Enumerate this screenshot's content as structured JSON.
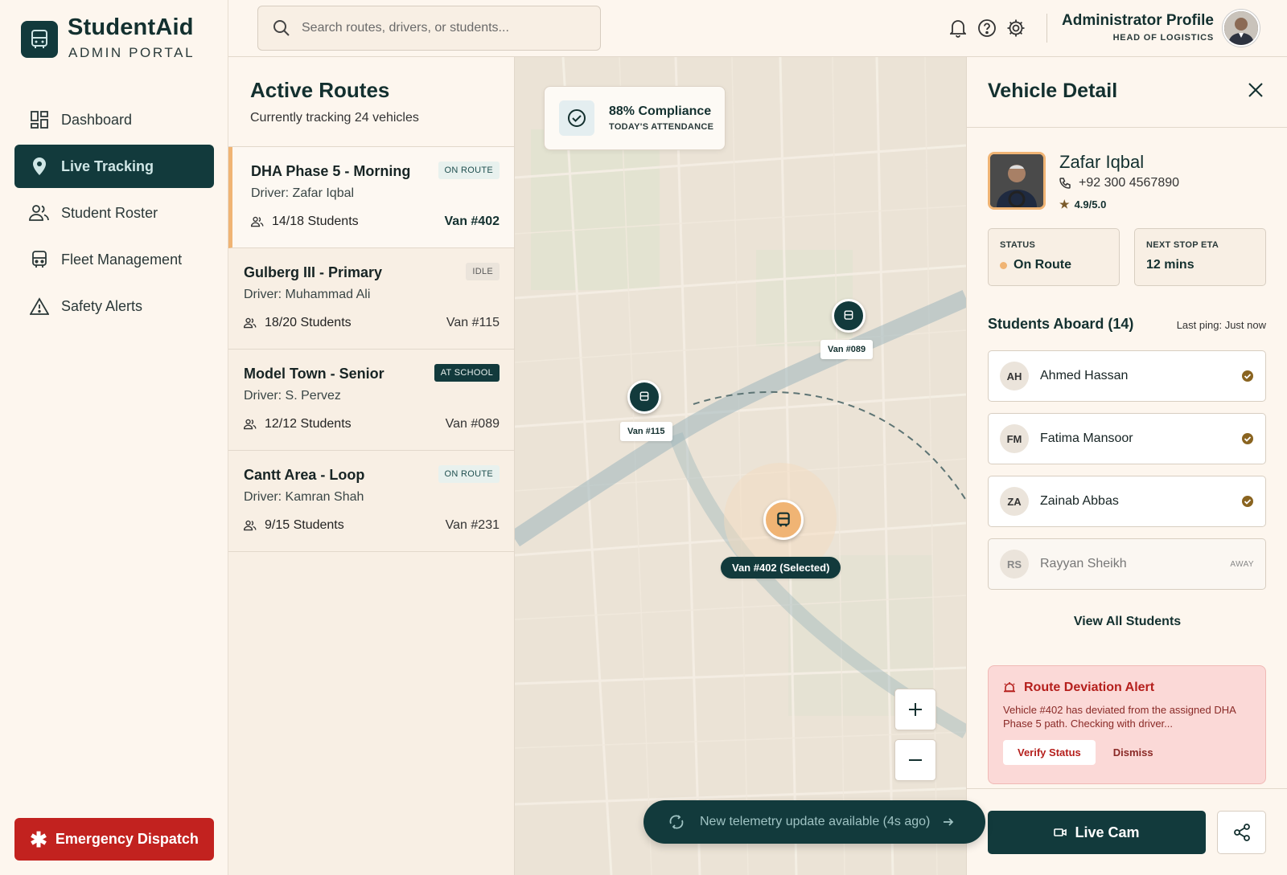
{
  "app": {
    "name": "StudentAid",
    "subtitle": "ADMIN PORTAL"
  },
  "sidebar": {
    "items": [
      {
        "label": "Dashboard",
        "icon": "dashboard-icon"
      },
      {
        "label": "Live Tracking",
        "icon": "location-pin-icon",
        "active": true
      },
      {
        "label": "Student Roster",
        "icon": "people-icon"
      },
      {
        "label": "Fleet Management",
        "icon": "bus-icon"
      },
      {
        "label": "Safety Alerts",
        "icon": "warning-icon"
      }
    ],
    "emergency_label": "Emergency Dispatch"
  },
  "search": {
    "placeholder": "Search routes, drivers, or students..."
  },
  "header": {
    "profile_name": "Administrator Profile",
    "profile_role": "HEAD OF LOGISTICS"
  },
  "routes": {
    "title": "Active Routes",
    "subtitle": "Currently tracking 24 vehicles",
    "items": [
      {
        "name": "DHA Phase 5 - Morning",
        "driver": "Driver: Zafar Iqbal",
        "status": "ON ROUTE",
        "students": "14/18 Students",
        "van": "Van #402"
      },
      {
        "name": "Gulberg III - Primary",
        "driver": "Driver: Muhammad Ali",
        "status": "IDLE",
        "students": "18/20 Students",
        "van": "Van #115"
      },
      {
        "name": "Model Town - Senior",
        "driver": "Driver: S. Pervez",
        "status": "AT SCHOOL",
        "students": "12/12 Students",
        "van": "Van #089"
      },
      {
        "name": "Cantt Area - Loop",
        "driver": "Driver: Kamran Shah",
        "status": "ON ROUTE",
        "students": "9/15 Students",
        "van": "Van #231"
      }
    ]
  },
  "map": {
    "compliance_value": "88% Compliance",
    "compliance_label": "TODAY'S ATTENDANCE",
    "markers": {
      "van089": "Van #089",
      "van115": "Van #115",
      "van402": "Van #402 (Selected)"
    },
    "telemetry": "New telemetry update available (4s ago)"
  },
  "detail": {
    "title": "Vehicle Detail",
    "driver_name": "Zafar Iqbal",
    "driver_phone": "+92 300 4567890",
    "driver_rating": "4.9/5.0",
    "status_label": "STATUS",
    "status_value": "On Route",
    "eta_label": "NEXT STOP ETA",
    "eta_value": "12 mins",
    "students_title": "Students Aboard (14)",
    "last_ping": "Last ping: Just now",
    "students": [
      {
        "initials": "AH",
        "name": "Ahmed Hassan",
        "state": "checked"
      },
      {
        "initials": "FM",
        "name": "Fatima Mansoor",
        "state": "checked"
      },
      {
        "initials": "ZA",
        "name": "Zainab Abbas",
        "state": "checked"
      },
      {
        "initials": "RS",
        "name": "Rayyan Sheikh",
        "state": "AWAY"
      }
    ],
    "view_all": "View All Students",
    "alert": {
      "title": "Route Deviation Alert",
      "body": "Vehicle #402 has deviated from the assigned DHA Phase 5 path. Checking with driver...",
      "verify": "Verify Status",
      "dismiss": "Dismiss"
    },
    "live_cam": "Live Cam"
  },
  "colors": {
    "primary": "#123a3c",
    "accent": "#f0b474",
    "danger": "#c2221f",
    "background": "#fdf6ee"
  }
}
